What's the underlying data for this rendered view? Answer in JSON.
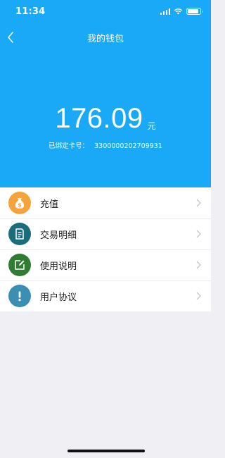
{
  "status_bar": {
    "time": "11:34",
    "battery_level": 0.9
  },
  "nav": {
    "title": "我的钱包"
  },
  "wallet": {
    "balance": "176.09",
    "unit": "元",
    "card_label": "已绑定卡号：",
    "card_number": "3300000202709931"
  },
  "menu": {
    "items": [
      {
        "label": "充值",
        "icon": "money-bag-icon",
        "color": "#f5a33b"
      },
      {
        "label": "交易明细",
        "icon": "document-icon",
        "color": "#1b6d7c"
      },
      {
        "label": "使用说明",
        "icon": "edit-icon",
        "color": "#2f7d32"
      },
      {
        "label": "用户协议",
        "icon": "info-icon",
        "color": "#3a8fb3"
      }
    ]
  },
  "colors": {
    "header": "#1aa9f7",
    "background": "#efeff4"
  }
}
